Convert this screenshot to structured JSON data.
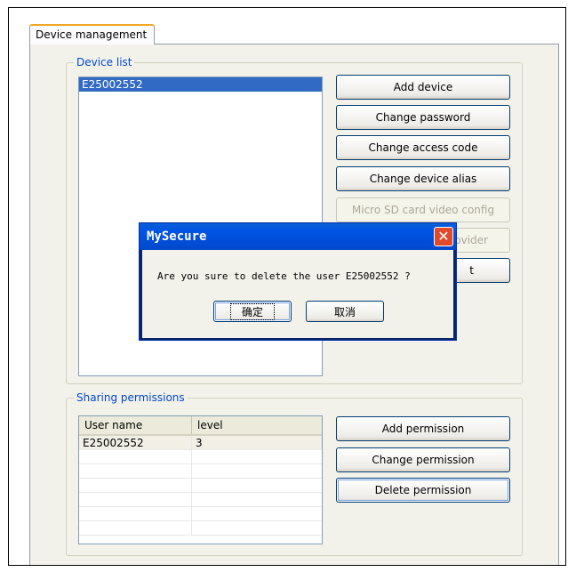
{
  "tab": {
    "label": "Device management"
  },
  "device_list": {
    "title": "Device list",
    "items": [
      "E25002552"
    ]
  },
  "device_buttons": {
    "add_device": "Add device",
    "change_password": "Change password",
    "change_access_code": "Change access code",
    "change_device_alias": "Change device alias",
    "micro_sd_config": "Micro SD card video config",
    "partial_provider": "ovider",
    "partial_hidden": "t"
  },
  "sharing": {
    "title": "Sharing permissions",
    "columns": [
      "User name",
      "level"
    ],
    "rows": [
      {
        "user": "E25002552",
        "level": "3"
      }
    ]
  },
  "sharing_buttons": {
    "add_permission": "Add permission",
    "change_permission": "Change permission",
    "delete_permission": "Delete permission"
  },
  "dialog": {
    "title": "MySecure",
    "message": "Are you sure to delete the user E25002552 ?",
    "ok_label": "确定",
    "cancel_label": "取消",
    "close_glyph": "✕"
  }
}
